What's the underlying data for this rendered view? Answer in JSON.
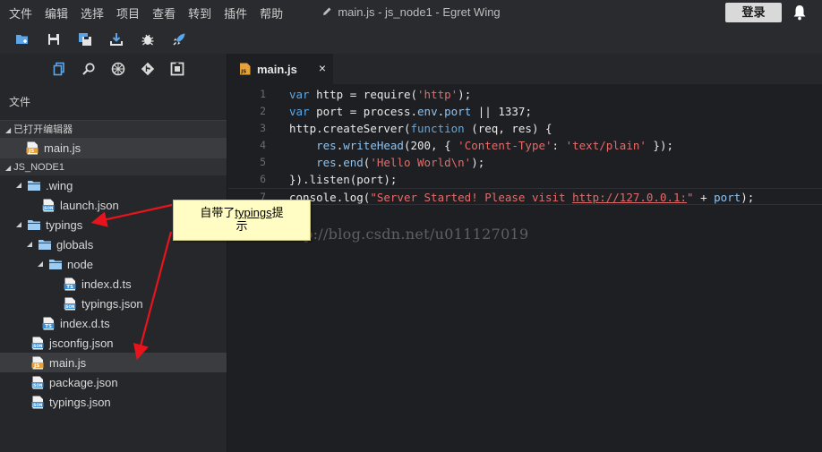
{
  "menu": {
    "items": [
      "文件",
      "编辑",
      "选择",
      "项目",
      "查看",
      "转到",
      "插件",
      "帮助"
    ]
  },
  "window": {
    "title": "main.js - js_node1 - Egret Wing",
    "login_label": "登录"
  },
  "toolbar": {
    "icons": [
      "new-folder-icon",
      "save-icon",
      "save-all-icon",
      "download-icon",
      "debug-icon",
      "rocket-icon"
    ]
  },
  "side": {
    "tab_icons": [
      "files-icon",
      "search-icon",
      "debug-icon",
      "git-icon",
      "extensions-icon"
    ],
    "panel_title": "文件",
    "open_editors_header": "已打开编辑器",
    "open_editors": [
      {
        "label": "main.js",
        "type": "js"
      }
    ],
    "project_header": "JS_NODE1",
    "tree": [
      {
        "label": ".wing",
        "type": "folder",
        "depth": 1,
        "expanded": true
      },
      {
        "label": "launch.json",
        "type": "json",
        "depth": 2
      },
      {
        "label": "typings",
        "type": "folder",
        "depth": 1,
        "expanded": true
      },
      {
        "label": "globals",
        "type": "folder",
        "depth": 2,
        "expanded": true
      },
      {
        "label": "node",
        "type": "folder",
        "depth": 3,
        "expanded": true
      },
      {
        "label": "index.d.ts",
        "type": "ts",
        "depth": 4
      },
      {
        "label": "typings.json",
        "type": "json",
        "depth": 4
      },
      {
        "label": "index.d.ts",
        "type": "ts",
        "depth": 2
      },
      {
        "label": "jsconfig.json",
        "type": "json",
        "depth": 1
      },
      {
        "label": "main.js",
        "type": "js",
        "depth": 1,
        "selected": true
      },
      {
        "label": "package.json",
        "type": "json",
        "depth": 1
      },
      {
        "label": "typings.json",
        "type": "json",
        "depth": 1
      }
    ]
  },
  "editor": {
    "tab_label": "main.js",
    "tab_close": "×",
    "lines": [
      {
        "n": "1",
        "parts": [
          [
            "kw",
            "var"
          ],
          [
            "id",
            " http "
          ],
          [
            "id",
            "= "
          ],
          [
            "id",
            "require("
          ],
          [
            "str",
            "'http'"
          ],
          [
            "id",
            ");"
          ]
        ]
      },
      {
        "n": "2",
        "parts": [
          [
            "kw",
            "var"
          ],
          [
            "id",
            " port "
          ],
          [
            "id",
            "= "
          ],
          [
            "id",
            "process"
          ],
          [
            "id",
            "."
          ],
          [
            "prop",
            "env"
          ],
          [
            "id",
            "."
          ],
          [
            "prop",
            "port"
          ],
          [
            "id",
            " || "
          ],
          [
            "id",
            "1337;"
          ]
        ]
      },
      {
        "n": "3",
        "parts": [
          [
            "id",
            "http"
          ],
          [
            "id",
            "."
          ],
          [
            "id",
            "createServer("
          ],
          [
            "kw",
            "function"
          ],
          [
            "id",
            " (req, res) {"
          ]
        ]
      },
      {
        "n": "4",
        "parts": [
          [
            "id",
            "    "
          ],
          [
            "prop",
            "res"
          ],
          [
            "id",
            "."
          ],
          [
            "prop",
            "writeHead"
          ],
          [
            "id",
            "(200, { "
          ],
          [
            "str",
            "'Content-Type'"
          ],
          [
            "id",
            ": "
          ],
          [
            "str",
            "'text/plain'"
          ],
          [
            "id",
            " });"
          ]
        ]
      },
      {
        "n": "5",
        "parts": [
          [
            "id",
            "    "
          ],
          [
            "prop",
            "res"
          ],
          [
            "id",
            "."
          ],
          [
            "prop",
            "end"
          ],
          [
            "id",
            "("
          ],
          [
            "str",
            "'Hello World\\n'"
          ],
          [
            "id",
            ");"
          ]
        ]
      },
      {
        "n": "6",
        "parts": [
          [
            "id",
            "})."
          ],
          [
            "id",
            "listen(port);"
          ]
        ]
      },
      {
        "n": "7",
        "parts": [
          [
            "id",
            "console"
          ],
          [
            "id",
            "."
          ],
          [
            "id",
            "log("
          ],
          [
            "str",
            "\"Server Started! Please visit "
          ],
          [
            "url",
            "http://127.0.0.1:"
          ],
          [
            "str",
            "\""
          ],
          [
            "id",
            " + "
          ],
          [
            "prop",
            "port"
          ],
          [
            "id",
            ");"
          ]
        ]
      }
    ],
    "current_line": 7
  },
  "watermark": "http://blog.csdn.net/u011127019",
  "annotation": {
    "prefix": "自带了",
    "highlight": "typings",
    "suffix": "提",
    "line2": "示"
  },
  "colors": {
    "arrow": "#e8141c",
    "js_badge": "#e8a23a",
    "ts_badge": "#3d8fd6",
    "json_badge": "#3d8fd6",
    "folder": "#9ecbf2"
  }
}
